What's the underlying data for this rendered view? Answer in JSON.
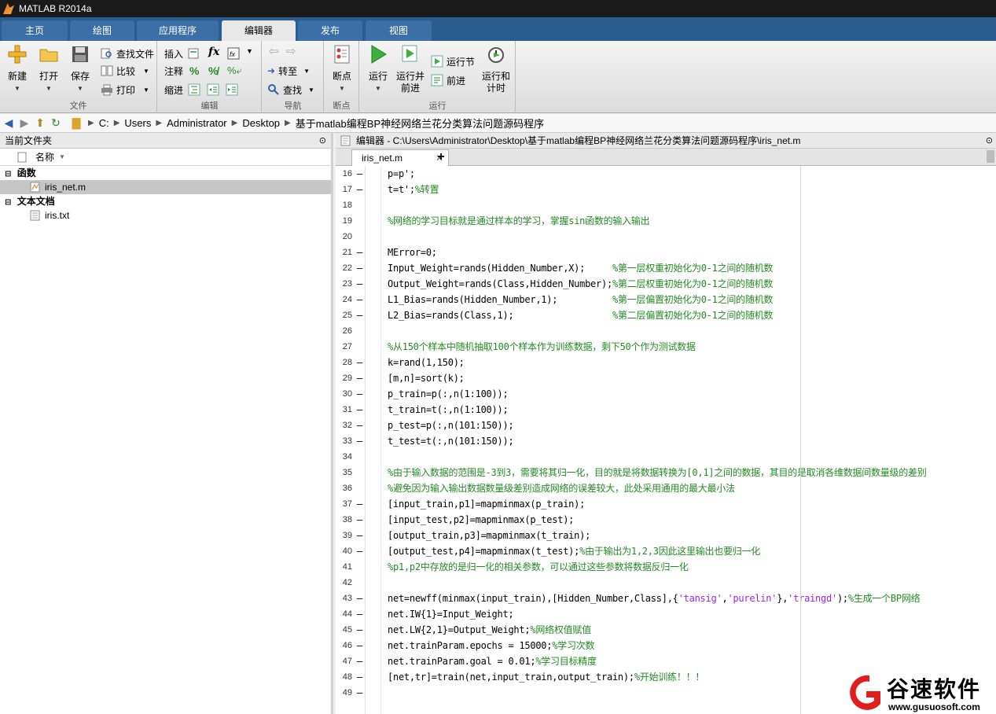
{
  "window": {
    "title": "MATLAB R2014a"
  },
  "tabs": [
    "主页",
    "绘图",
    "应用程序",
    "编辑器",
    "发布",
    "视图"
  ],
  "ribbon": {
    "file": {
      "group": "文件",
      "new": "新建",
      "open": "打开",
      "save": "保存",
      "find_files": "查找文件",
      "compare": "比较",
      "print": "打印"
    },
    "edit": {
      "group": "编辑",
      "insert": "插入",
      "comment": "注释",
      "indent": "缩进",
      "fx": "fx"
    },
    "navigate": {
      "group": "导航",
      "goto": "转至",
      "find": "查找"
    },
    "breakpoints": {
      "group": "断点",
      "label": "断点"
    },
    "run": {
      "group": "运行",
      "run": "运行",
      "run_advance_1": "运行并",
      "run_advance_2": "前进",
      "run_section": "运行节",
      "advance": "前进",
      "run_time_1": "运行和",
      "run_time_2": "计时"
    }
  },
  "address": {
    "parts": [
      "C:",
      "Users",
      "Administrator",
      "Desktop",
      "基于matlab编程BP神经网络兰花分类算法问题源码程序"
    ]
  },
  "left": {
    "title": "当前文件夹",
    "col_name": "名称",
    "groups": [
      {
        "name": "函数",
        "files": [
          "iris_net.m"
        ]
      },
      {
        "name": "文本文档",
        "files": [
          "iris.txt"
        ]
      }
    ]
  },
  "editor": {
    "title": "编辑器 - C:\\Users\\Administrator\\Desktop\\基于matlab编程BP神经网络兰花分类算法问题源码程序\\iris_net.m",
    "tab": "iris_net.m",
    "add_tab": "+",
    "lines": [
      {
        "n": "16",
        "dash": true,
        "code": "p=p';",
        "comment": ""
      },
      {
        "n": "17",
        "dash": true,
        "code": "t=t';",
        "comment": "%转置"
      },
      {
        "n": "18",
        "dash": false,
        "code": "",
        "comment": ""
      },
      {
        "n": "19",
        "dash": false,
        "code": "",
        "comment": "%网络的学习目标就是通过样本的学习，掌握sin函数的输入输出"
      },
      {
        "n": "20",
        "dash": false,
        "code": "",
        "comment": ""
      },
      {
        "n": "21",
        "dash": true,
        "code": "MError=0;",
        "comment": ""
      },
      {
        "n": "22",
        "dash": true,
        "code": "Input_Weight=rands(Hidden_Number,X);     ",
        "comment": "%第一层权重初始化为0-1之间的随机数"
      },
      {
        "n": "23",
        "dash": true,
        "code": "Output_Weight=rands(Class,Hidden_Number);",
        "comment": "%第二层权重初始化为0-1之间的随机数"
      },
      {
        "n": "24",
        "dash": true,
        "code": "L1_Bias=rands(Hidden_Number,1);          ",
        "comment": "%第一层偏置初始化为0-1之间的随机数"
      },
      {
        "n": "25",
        "dash": true,
        "code": "L2_Bias=rands(Class,1);                  ",
        "comment": "%第二层偏置初始化为0-1之间的随机数"
      },
      {
        "n": "26",
        "dash": false,
        "code": "",
        "comment": ""
      },
      {
        "n": "27",
        "dash": false,
        "code": "",
        "comment": "%从150个样本中随机抽取100个样本作为训练数据，剩下50个作为测试数据"
      },
      {
        "n": "28",
        "dash": true,
        "code": "k=rand(1,150);",
        "comment": ""
      },
      {
        "n": "29",
        "dash": true,
        "code": "[m,n]=sort(k);",
        "comment": ""
      },
      {
        "n": "30",
        "dash": true,
        "code": "p_train=p(:,n(1:100));",
        "comment": ""
      },
      {
        "n": "31",
        "dash": true,
        "code": "t_train=t(:,n(1:100));",
        "comment": ""
      },
      {
        "n": "32",
        "dash": true,
        "code": "p_test=p(:,n(101:150));",
        "comment": ""
      },
      {
        "n": "33",
        "dash": true,
        "code": "t_test=t(:,n(101:150));",
        "comment": ""
      },
      {
        "n": "34",
        "dash": false,
        "code": "",
        "comment": ""
      },
      {
        "n": "35",
        "dash": false,
        "code": "",
        "comment": "%由于输入数据的范围是-3到3，需要将其归一化，目的就是将数据转换为[0,1]之间的数据，其目的是取消各维数据间数量级的差别"
      },
      {
        "n": "36",
        "dash": false,
        "code": "",
        "comment": "%避免因为输入输出数据数量级差别造成网络的误差较大，此处采用通用的最大最小法"
      },
      {
        "n": "37",
        "dash": true,
        "code": "[input_train,p1]=mapminmax(p_train);",
        "comment": ""
      },
      {
        "n": "38",
        "dash": true,
        "code": "[input_test,p2]=mapminmax(p_test);",
        "comment": ""
      },
      {
        "n": "39",
        "dash": true,
        "code": "[output_train,p3]=mapminmax(t_train);",
        "comment": ""
      },
      {
        "n": "40",
        "dash": true,
        "code": "[output_test,p4]=mapminmax(t_test);",
        "comment": "%由于输出为1,2,3因此这里输出也要归一化"
      },
      {
        "n": "41",
        "dash": false,
        "code": "",
        "comment": "%p1,p2中存放的是归一化的相关参数，可以通过这些参数将数据反归一化"
      },
      {
        "n": "42",
        "dash": false,
        "code": "",
        "comment": ""
      },
      {
        "n": "43",
        "dash": true,
        "code": "net=newff(minmax(input_train),[Hidden_Number,Class],{",
        "str1": "'tansig'",
        "mid1": ",",
        "str2": "'purelin'",
        "mid2": "},",
        "str3": "'traingd'",
        "tail": ");",
        "comment": "%生成一个BP网络"
      },
      {
        "n": "44",
        "dash": true,
        "code": "net.IW{1}=Input_Weight;",
        "comment": ""
      },
      {
        "n": "45",
        "dash": true,
        "code": "net.LW{2,1}=Output_Weight;",
        "comment": "%网络权值赋值"
      },
      {
        "n": "46",
        "dash": true,
        "code": "net.trainParam.epochs = 15000;",
        "comment": "%学习次数"
      },
      {
        "n": "47",
        "dash": true,
        "code": "net.trainParam.goal = 0.01;",
        "comment": "%学习目标精度"
      },
      {
        "n": "48",
        "dash": true,
        "code": "[net,tr]=train(net,input_train,output_train);",
        "comment": "%开始训练！！！"
      },
      {
        "n": "49",
        "dash": true,
        "code": "",
        "comment": ""
      }
    ]
  },
  "watermark": {
    "name": "谷速软件",
    "url": "www.gusuosoft.com"
  },
  "colors": {
    "tab_bar": "#2b5c8f",
    "comment": "#228b22",
    "string": "#a020f0"
  }
}
